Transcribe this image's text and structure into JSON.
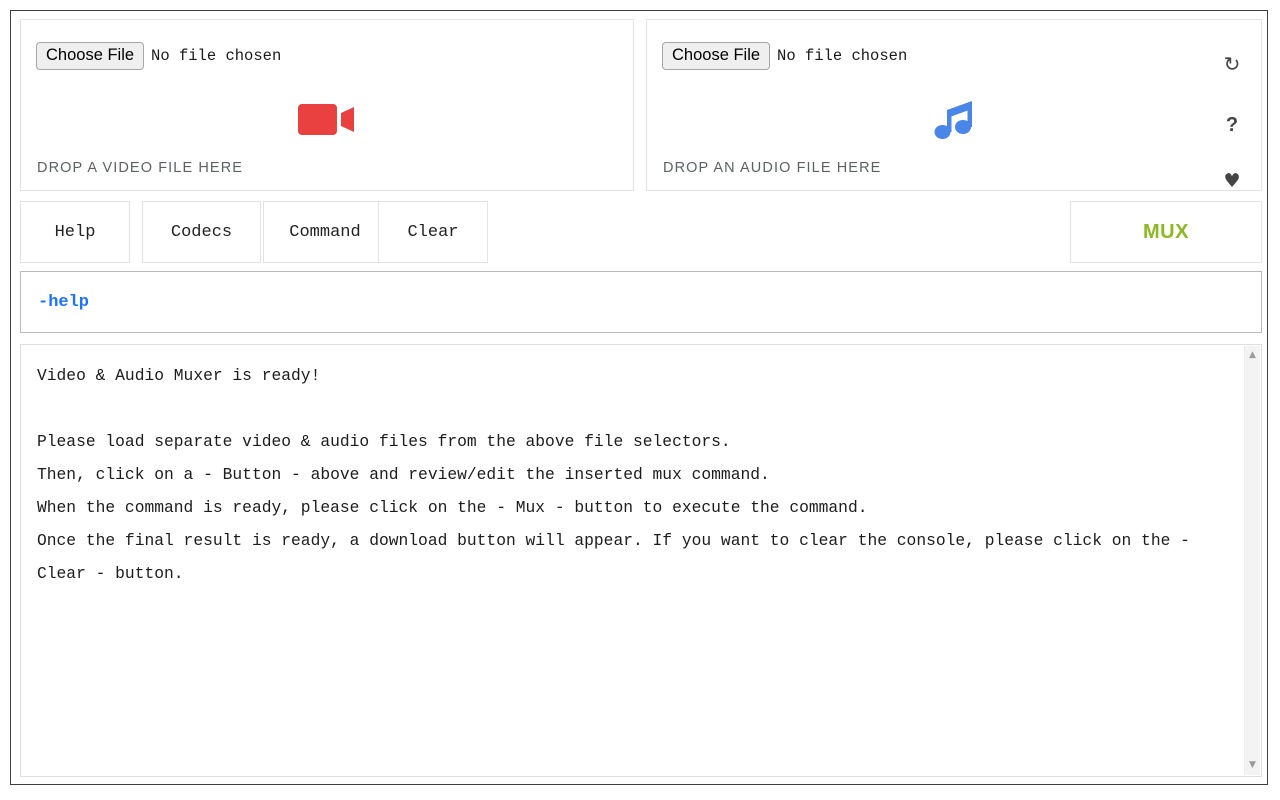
{
  "video_panel": {
    "choose_button": "Choose File",
    "file_status": "No file chosen",
    "drop_label": "DROP A VIDEO FILE HERE",
    "icon": "video-camera-icon",
    "icon_color": "#e8413f"
  },
  "audio_panel": {
    "choose_button": "Choose File",
    "file_status": "No file chosen",
    "drop_label": "DROP AN AUDIO FILE HERE",
    "icon": "music-note-icon",
    "icon_color": "#4a86e8",
    "rail": {
      "reload": "↻",
      "help": "?",
      "heart": "♥"
    }
  },
  "toolbar": {
    "help_label": "Help",
    "codecs_label": "Codecs",
    "command_label": "Command",
    "clear_label": "Clear",
    "mux_label": "MUX",
    "mux_color": "#8bb922"
  },
  "command_field": {
    "value": "-help",
    "placeholder": "",
    "color": "#1a73ff"
  },
  "console": {
    "text": "Video & Audio Muxer is ready!\n\nPlease load separate video & audio files from the above file selectors.\nThen, click on a - Button - above and review/edit the inserted mux command.\nWhen the command is ready, please click on the - Mux - button to execute the command.\nOnce the final result is ready, a download button will appear. If you want to clear the console, please click on the - Clear - button.",
    "scrollbar": {
      "up_arrow": "▲",
      "down_arrow": "▼"
    }
  }
}
